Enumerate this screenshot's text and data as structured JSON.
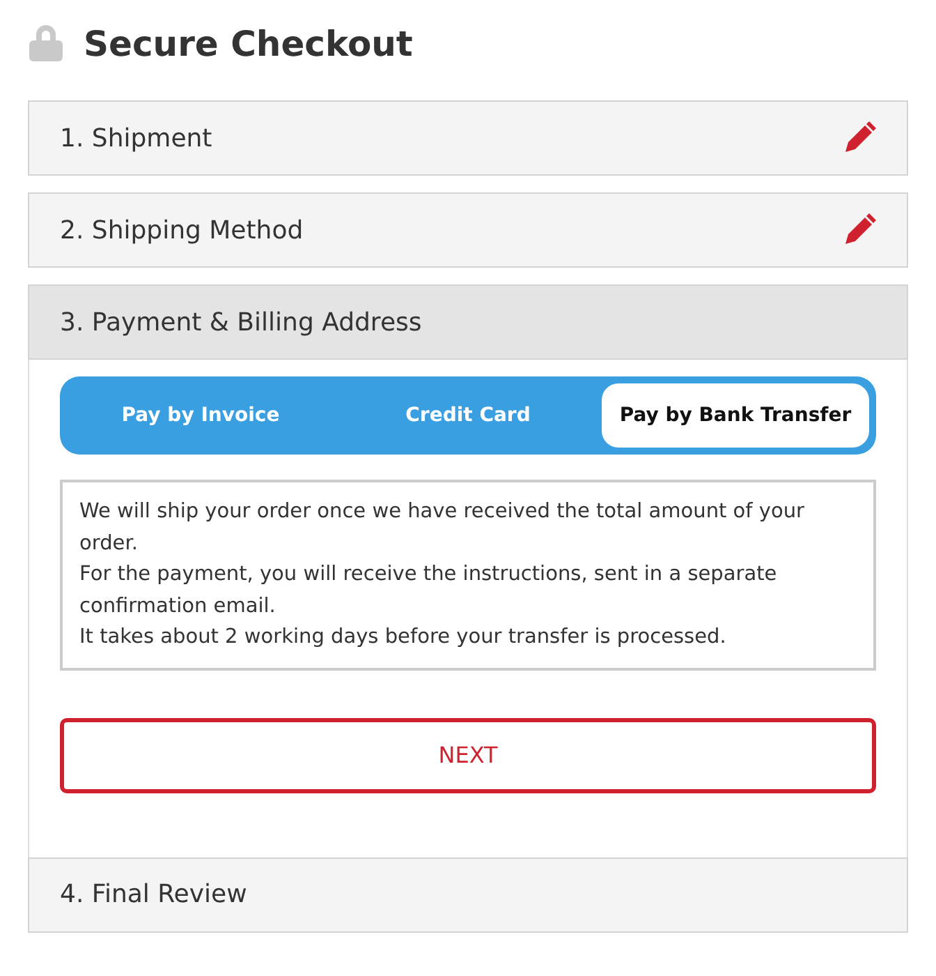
{
  "title": "Secure Checkout",
  "steps": [
    {
      "label": "1. Shipment",
      "editable": true,
      "expanded": false
    },
    {
      "label": "2. Shipping Method",
      "editable": true,
      "expanded": false
    },
    {
      "label": "3. Payment & Billing Address",
      "editable": false,
      "expanded": true
    },
    {
      "label": "4. Final Review",
      "editable": false,
      "expanded": false
    }
  ],
  "payment": {
    "tabs": [
      {
        "label": "Pay by Invoice",
        "selected": false
      },
      {
        "label": "Credit Card",
        "selected": false
      },
      {
        "label": "Pay by Bank Transfer",
        "selected": true
      }
    ],
    "info": [
      "We will ship your order once we have received the total amount of your order.",
      "For the payment, you will receive the instructions, sent in a separate confirmation email.",
      "It takes about 2 working days before your transfer is processed."
    ],
    "next_button": "NEXT"
  }
}
